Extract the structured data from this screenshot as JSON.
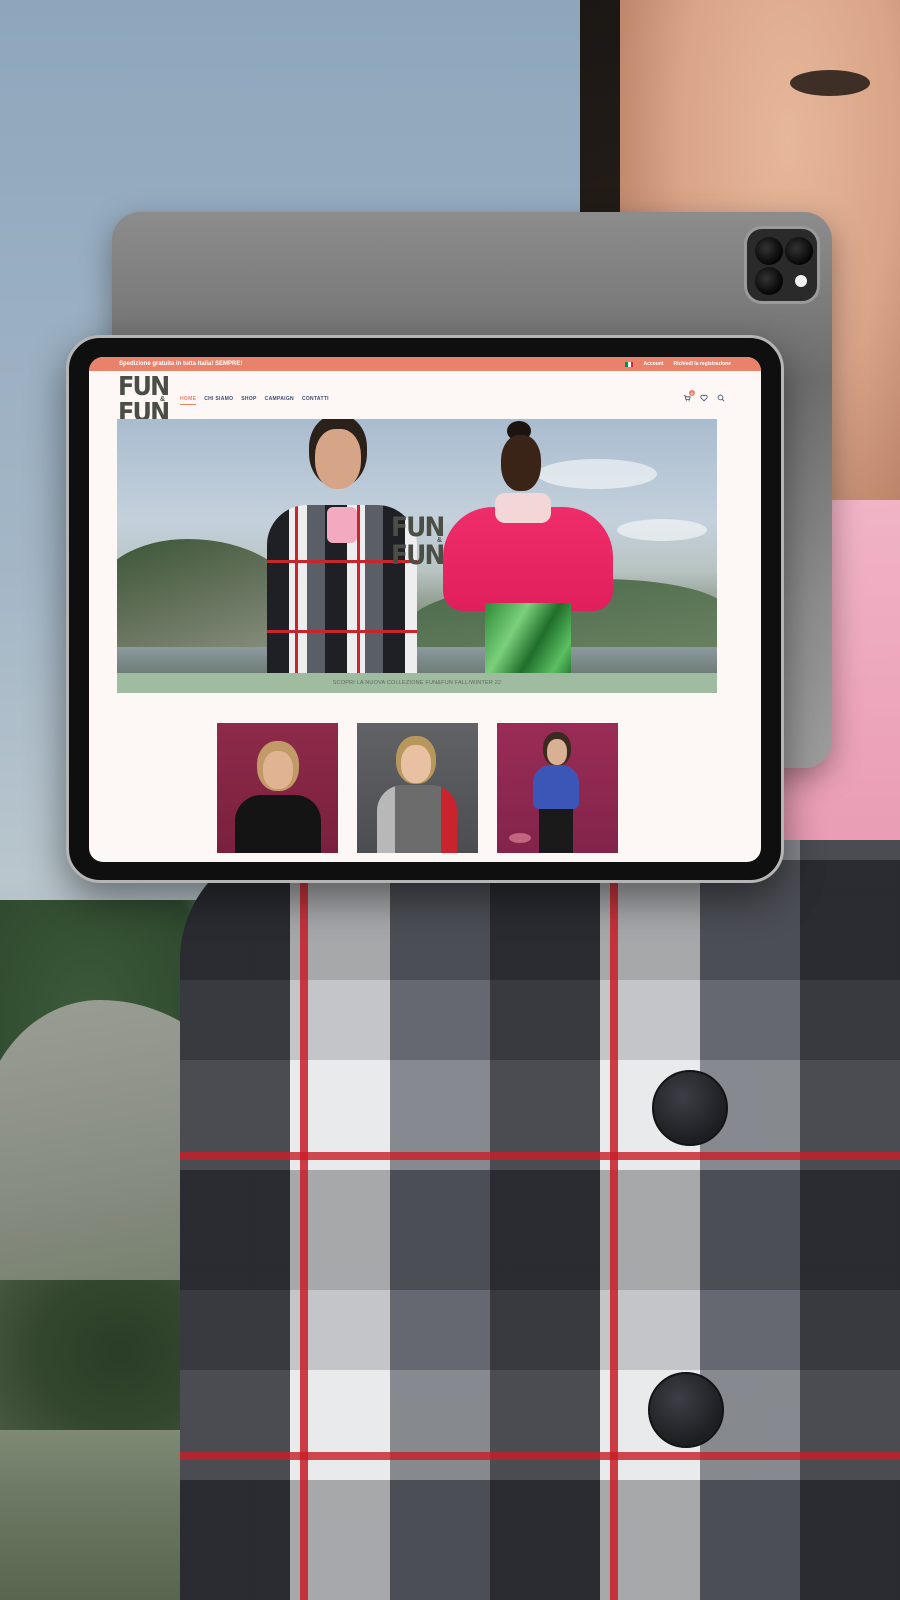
{
  "topbar": {
    "shipping_text": "Spedizione gratuita in tutta Italia! SEMPRE!",
    "account_label": "Account",
    "register_label": "Richiedi la registrazione",
    "flag_colors": [
      "#009246",
      "#ffffff",
      "#ce2b37"
    ]
  },
  "logo": {
    "word1": "FUN",
    "amp": "&",
    "word2": "FUN"
  },
  "nav": {
    "items": [
      {
        "label": "HOME",
        "active": true
      },
      {
        "label": "CHI SIAMO"
      },
      {
        "label": "SHOP"
      },
      {
        "label": "CAMPAIGN"
      },
      {
        "label": "CONTATTI"
      }
    ],
    "cart_count": "0",
    "icons": [
      "cart-icon",
      "heart-icon",
      "search-icon"
    ]
  },
  "hero": {
    "logo_word1": "FUN",
    "logo_amp": "&",
    "logo_word2": "FUN",
    "banner_text": "SCOPRI LA NUOVA COLLEZIONE FUN&FUN FALL/WINTER 22"
  },
  "colors": {
    "accent": "#e8826b",
    "banner": "#9fbba0",
    "nav_text": "#3b4a6b",
    "logo": "#4a4e45"
  }
}
